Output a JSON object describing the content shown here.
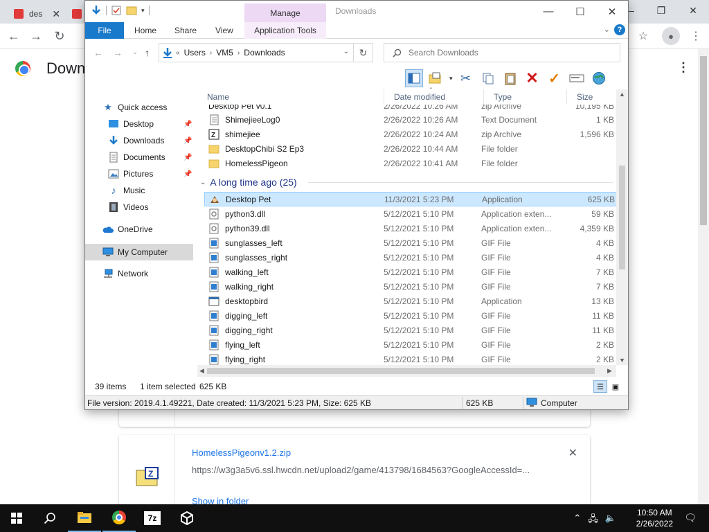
{
  "chrome": {
    "tabs": [
      {
        "label": "des"
      },
      {
        "label": ""
      }
    ],
    "page_title": "Down",
    "downloads": [
      {
        "name": "HomelessPigeonv1.2.zip",
        "url": "https://w3g3a5v6.ssl.hwcdn.net/upload2/game/413798/1684563?GoogleAccessId=...",
        "show_in_folder": "Show in folder"
      }
    ]
  },
  "explorer": {
    "title": "Downloads",
    "manage_label": "Manage",
    "ribbon_tabs": [
      "File",
      "Home",
      "Share",
      "View",
      "Application Tools"
    ],
    "address": {
      "prefix": "«",
      "crumbs": [
        "Users",
        "VM5",
        "Downloads"
      ]
    },
    "search_placeholder": "Search Downloads",
    "nav": {
      "quick_access": "Quick access",
      "items": [
        "Desktop",
        "Downloads",
        "Documents",
        "Pictures",
        "Music",
        "Videos"
      ],
      "onedrive": "OneDrive",
      "my_computer": "My Computer",
      "network": "Network"
    },
    "columns": [
      "Name",
      "Date modified",
      "Type",
      "Size"
    ],
    "partial_row": {
      "name": "Desktop Pet v0.1",
      "date": "2/26/2022 10:26 AM",
      "type": "zip Archive",
      "size": "10,195 KB"
    },
    "recent_files": [
      {
        "name": "ShimejieeLog0",
        "date": "2/26/2022 10:26 AM",
        "type": "Text Document",
        "size": "1 KB",
        "icon": "text-file-icon"
      },
      {
        "name": "shimejiee",
        "date": "2/26/2022 10:24 AM",
        "type": "zip Archive",
        "size": "1,596 KB",
        "icon": "zip-icon"
      },
      {
        "name": "DesktopChibi S2 Ep3",
        "date": "2/26/2022 10:44 AM",
        "type": "File folder",
        "size": "",
        "icon": "folder-icon"
      },
      {
        "name": "HomelessPigeon",
        "date": "2/26/2022 10:41 AM",
        "type": "File folder",
        "size": "",
        "icon": "folder-icon"
      }
    ],
    "group_label": "A long time ago (25)",
    "old_files": [
      {
        "name": "Desktop Pet",
        "date": "11/3/2021 5:23 PM",
        "type": "Application",
        "size": "625 KB",
        "icon": "app-pet-icon",
        "selected": true
      },
      {
        "name": "python3.dll",
        "date": "5/12/2021 5:10 PM",
        "type": "Application exten...",
        "size": "59 KB",
        "icon": "dll-icon"
      },
      {
        "name": "python39.dll",
        "date": "5/12/2021 5:10 PM",
        "type": "Application exten...",
        "size": "4,359 KB",
        "icon": "dll-icon"
      },
      {
        "name": "sunglasses_left",
        "date": "5/12/2021 5:10 PM",
        "type": "GIF File",
        "size": "4 KB",
        "icon": "gif-icon"
      },
      {
        "name": "sunglasses_right",
        "date": "5/12/2021 5:10 PM",
        "type": "GIF File",
        "size": "4 KB",
        "icon": "gif-icon"
      },
      {
        "name": "walking_left",
        "date": "5/12/2021 5:10 PM",
        "type": "GIF File",
        "size": "7 KB",
        "icon": "gif-icon"
      },
      {
        "name": "walking_right",
        "date": "5/12/2021 5:10 PM",
        "type": "GIF File",
        "size": "7 KB",
        "icon": "gif-icon"
      },
      {
        "name": "desktopbird",
        "date": "5/12/2021 5:10 PM",
        "type": "Application",
        "size": "13 KB",
        "icon": "app-icon"
      },
      {
        "name": "digging_left",
        "date": "5/12/2021 5:10 PM",
        "type": "GIF File",
        "size": "11 KB",
        "icon": "gif-icon"
      },
      {
        "name": "digging_right",
        "date": "5/12/2021 5:10 PM",
        "type": "GIF File",
        "size": "11 KB",
        "icon": "gif-icon"
      },
      {
        "name": "flying_left",
        "date": "5/12/2021 5:10 PM",
        "type": "GIF File",
        "size": "2 KB",
        "icon": "gif-icon"
      },
      {
        "name": "flying_right",
        "date": "5/12/2021 5:10 PM",
        "type": "GIF File",
        "size": "2 KB",
        "icon": "gif-icon"
      }
    ],
    "status": {
      "items": "39 items",
      "selected": "1 item selected",
      "size": "625 KB"
    },
    "infobar": {
      "details": "File version: 2019.4.1.49221, Date created: 11/3/2021 5:23 PM, Size: 625 KB",
      "size": "625 KB",
      "location": "Computer"
    }
  },
  "taskbar": {
    "apps": [
      "start-icon",
      "search-icon",
      "file-explorer-icon",
      "chrome-icon",
      "7zip-icon",
      "unity-icon"
    ],
    "zip_label": "7z",
    "time": "10:50 AM",
    "date": "2/26/2022"
  },
  "colors": {
    "accent": "#1979ca",
    "manage_tab": "#eed9f5",
    "selection": "#cce8ff",
    "link": "#1a73e8",
    "taskbar": "#101010"
  }
}
